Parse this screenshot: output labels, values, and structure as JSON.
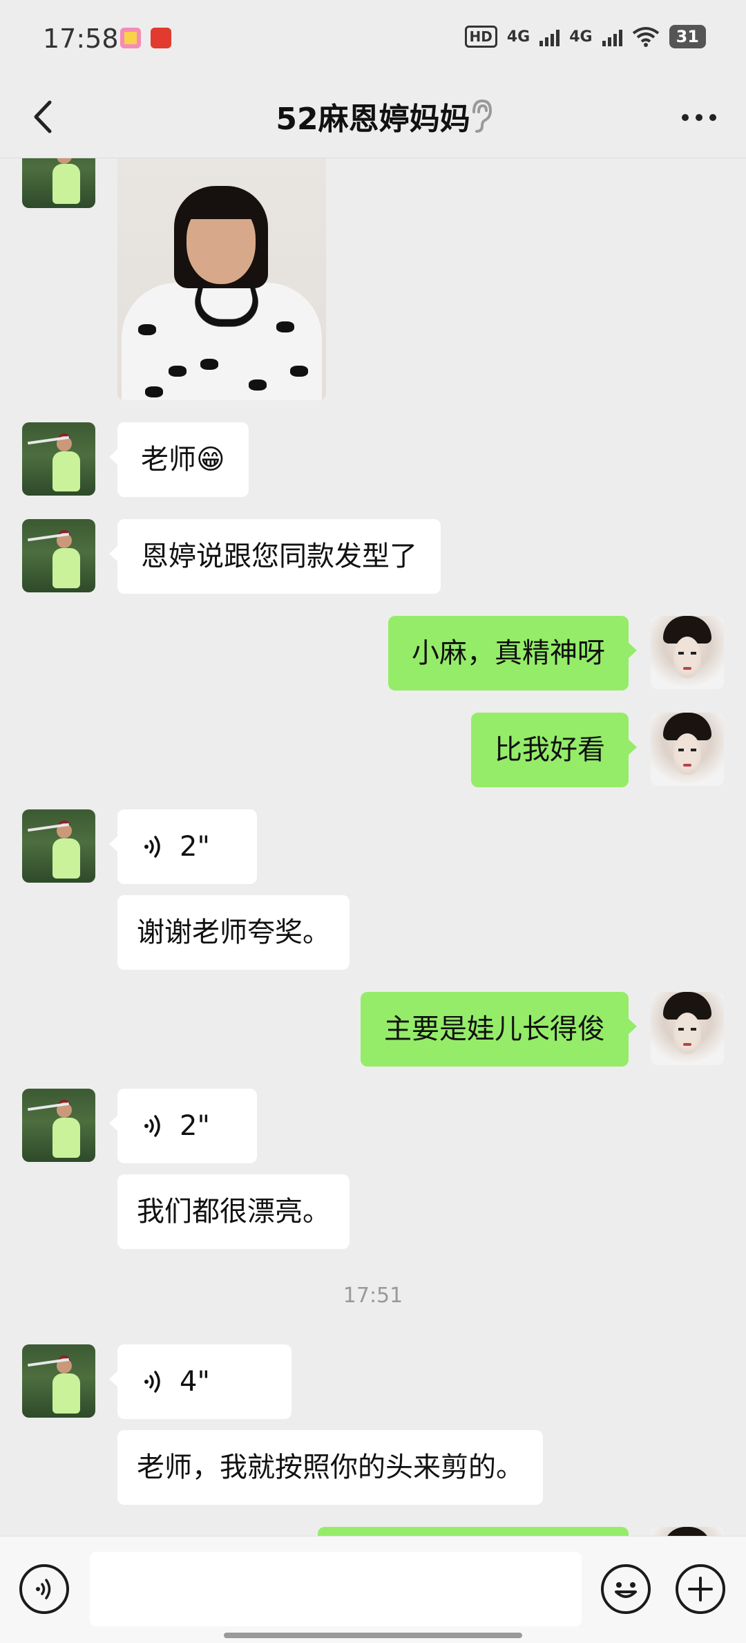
{
  "status_bar": {
    "time": "17:58",
    "hd_label": "HD",
    "network_1": "4G",
    "network_2": "4G",
    "battery": "31",
    "app_icons": [
      "pink-app-icon",
      "red-app-icon"
    ]
  },
  "nav": {
    "title": "52麻恩婷妈妈",
    "back_icon": "chevron-left-icon",
    "ear_icon": "ear-icon",
    "more_icon": "more-dots-icon"
  },
  "messages": [
    {
      "side": "left",
      "type": "image",
      "description_icon": "photo"
    },
    {
      "side": "left",
      "type": "text",
      "text": "老师😁"
    },
    {
      "side": "left",
      "type": "text",
      "text": "恩婷说跟您同款发型了"
    },
    {
      "side": "right",
      "type": "text",
      "text": "小麻，真精神呀"
    },
    {
      "side": "right",
      "type": "text",
      "text": "比我好看"
    },
    {
      "side": "left",
      "type": "voice",
      "duration": "2\""
    },
    {
      "side": "left",
      "type": "text",
      "text": "谢谢老师夸奖。"
    },
    {
      "side": "right",
      "type": "text",
      "text": "主要是娃儿长得俊"
    },
    {
      "side": "left",
      "type": "voice",
      "duration": "2\""
    },
    {
      "side": "left",
      "type": "text",
      "text": "我们都很漂亮。"
    },
    {
      "type": "timestamp",
      "text": "17:51"
    },
    {
      "side": "left",
      "type": "voice",
      "duration": "4\""
    },
    {
      "side": "left",
      "type": "text",
      "text": "老师，我就按照你的头来剪的。"
    }
  ],
  "input_bar": {
    "voice_icon": "voice-input-icon",
    "input_value": "",
    "emoji_icon": "emoji-icon",
    "plus_icon": "plus-icon"
  },
  "colors": {
    "background": "#ededed",
    "own_bubble": "#95ec69",
    "other_bubble": "#ffffff"
  }
}
